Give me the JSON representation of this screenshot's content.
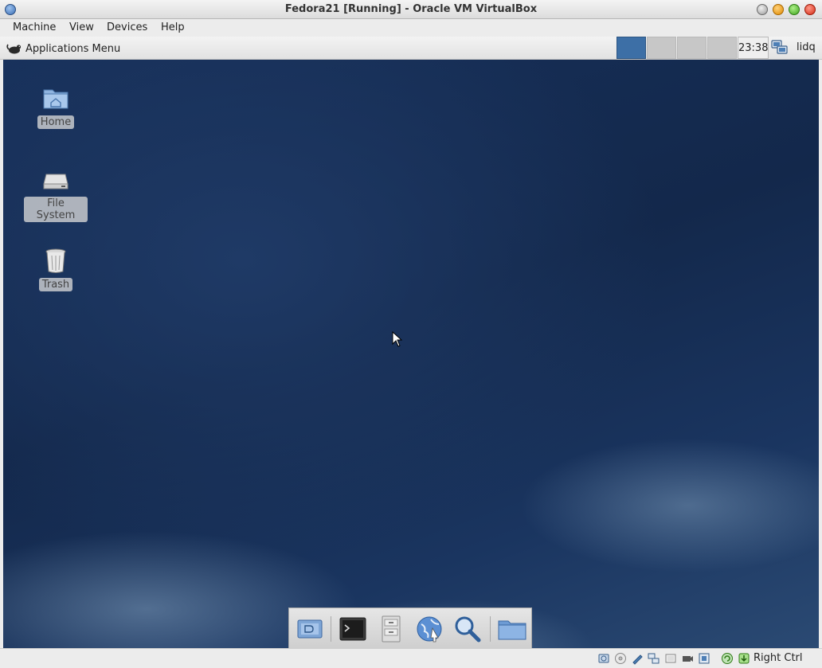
{
  "window": {
    "title": "Fedora21 [Running] - Oracle VM VirtualBox"
  },
  "vbox_menu": {
    "items": [
      {
        "label": "Machine"
      },
      {
        "label": "View"
      },
      {
        "label": "Devices"
      },
      {
        "label": "Help"
      }
    ]
  },
  "guest_panel": {
    "apps_menu_label": "Applications Menu",
    "apps_menu_icon": "xfce-mouse-icon",
    "workspaces": [
      {
        "name": "workspace-1",
        "active": true
      },
      {
        "name": "workspace-2",
        "active": false
      },
      {
        "name": "workspace-3",
        "active": false
      },
      {
        "name": "workspace-4",
        "active": false
      }
    ],
    "clock": "23:38",
    "network_icon": "network-icon",
    "user": "lidq"
  },
  "desktop": {
    "icons": [
      {
        "label": "Home",
        "icon": "home-folder-icon"
      },
      {
        "label": "File System",
        "icon": "hard-drive-icon"
      },
      {
        "label": "Trash",
        "icon": "trash-icon"
      }
    ],
    "colors": {
      "background_dark": "#13284b",
      "background_light": "#2b4a73"
    }
  },
  "dock": {
    "items": [
      {
        "name": "show-desktop",
        "icon": "show-desktop-icon"
      },
      {
        "name": "terminal",
        "icon": "terminal-icon"
      },
      {
        "name": "file-manager",
        "icon": "file-manager-icon"
      },
      {
        "name": "web-browser",
        "icon": "web-browser-icon"
      },
      {
        "name": "app-finder",
        "icon": "search-icon"
      },
      {
        "name": "folder",
        "icon": "folder-icon"
      }
    ]
  },
  "statusbar": {
    "icons": [
      "hard-disk-icon",
      "optical-drive-icon",
      "usb-icon",
      "shared-folders-icon",
      "display-icon",
      "video-capture-icon",
      "network-icon",
      "cpu-icon",
      "mouse-integration-icon",
      "host-key-icon"
    ],
    "host_key": "Right Ctrl"
  },
  "theme": {
    "accent": "#3d6fa6"
  }
}
